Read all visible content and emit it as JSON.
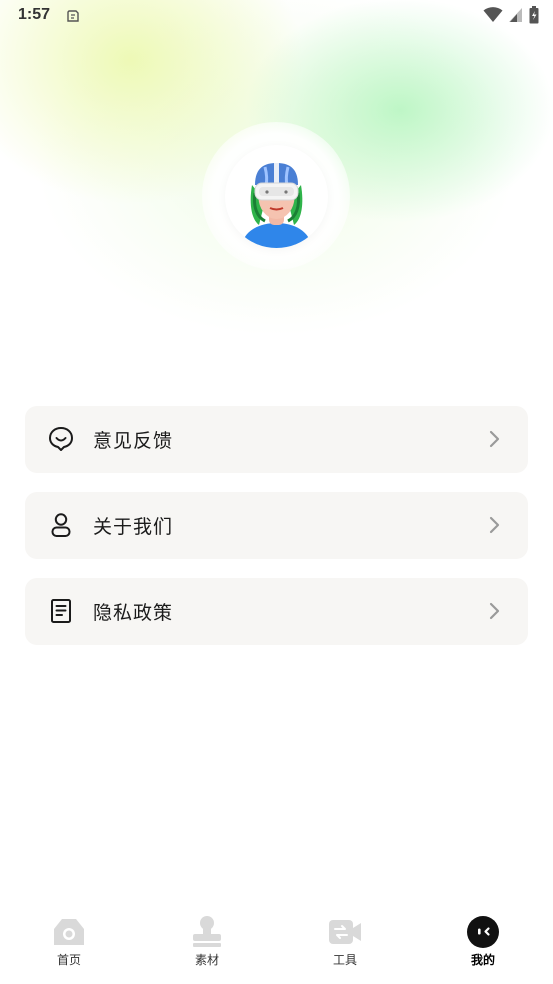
{
  "status_bar": {
    "time": "1:57"
  },
  "menu": [
    {
      "label": "意见反馈",
      "icon": "smile-feedback-icon"
    },
    {
      "label": "关于我们",
      "icon": "person-icon"
    },
    {
      "label": "隐私政策",
      "icon": "document-icon"
    }
  ],
  "bottom_nav": [
    {
      "label": "首页",
      "icon": "home-camera-icon",
      "active": false
    },
    {
      "label": "素材",
      "icon": "stamp-icon",
      "active": false
    },
    {
      "label": "工具",
      "icon": "video-tool-icon",
      "active": false
    },
    {
      "label": "我的",
      "icon": "profile-face-icon",
      "active": true
    }
  ],
  "colors": {
    "card_bg": "#f7f6f4",
    "inactive_icon": "#d9d9d9",
    "active_icon": "#111111"
  }
}
